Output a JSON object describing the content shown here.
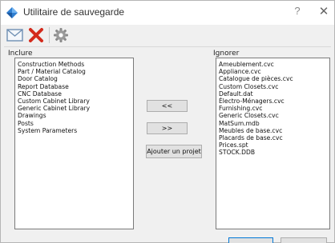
{
  "window": {
    "title": "Utilitaire de sauvegarde",
    "help_glyph": "?",
    "close_glyph": "✕"
  },
  "toolbar": {
    "icons": [
      "envelope-icon",
      "red-x-icon",
      "gear-icon"
    ]
  },
  "include": {
    "label": "Inclure",
    "items": [
      "Construction Methods",
      "Part / Material Catalog",
      "Door Catalog",
      "Report Database",
      "CNC Database",
      "Custom Cabinet Library",
      "Generic Cabinet Library",
      "Drawings",
      "Posts",
      "System Parameters"
    ]
  },
  "ignore": {
    "label": "Ignorer",
    "items": [
      "Ameublement.cvc",
      "Appliance.cvc",
      "Catalogue de pièces.cvc",
      "Custom Closets.cvc",
      "Default.dat",
      "Électro-Ménagers.cvc",
      "Furnishing.cvc",
      "Generic Closets.cvc",
      "MatSum.mdb",
      "Meubles de base.cvc",
      "Placards de base.cvc",
      "Prices.spt",
      "STOCK.DDB"
    ]
  },
  "buttons": {
    "move_left": "<<",
    "move_right": ">>",
    "add_project": "Ajouter un projet"
  },
  "colors": {
    "accent_green": "#5fbf73",
    "primary_blue": "#0078d7",
    "delete_red": "#d42a1c"
  }
}
